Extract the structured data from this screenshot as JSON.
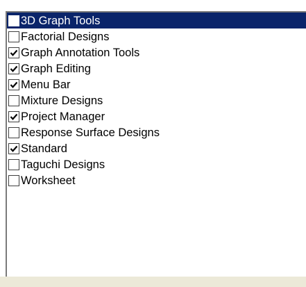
{
  "list": {
    "items": [
      {
        "label": "3D Graph Tools",
        "checked": false,
        "selected": true
      },
      {
        "label": "Factorial Designs",
        "checked": false,
        "selected": false
      },
      {
        "label": "Graph Annotation Tools",
        "checked": true,
        "selected": false
      },
      {
        "label": "Graph Editing",
        "checked": true,
        "selected": false
      },
      {
        "label": "Menu Bar",
        "checked": true,
        "selected": false
      },
      {
        "label": "Mixture Designs",
        "checked": false,
        "selected": false
      },
      {
        "label": "Project Manager",
        "checked": true,
        "selected": false
      },
      {
        "label": "Response Surface Designs",
        "checked": false,
        "selected": false
      },
      {
        "label": "Standard",
        "checked": true,
        "selected": false
      },
      {
        "label": "Taguchi Designs",
        "checked": false,
        "selected": false
      },
      {
        "label": "Worksheet",
        "checked": false,
        "selected": false
      }
    ]
  },
  "colors": {
    "selection": "#0a246a",
    "dialog_bg": "#ece9d8"
  },
  "icons": {
    "checked": "checkmark-icon"
  }
}
